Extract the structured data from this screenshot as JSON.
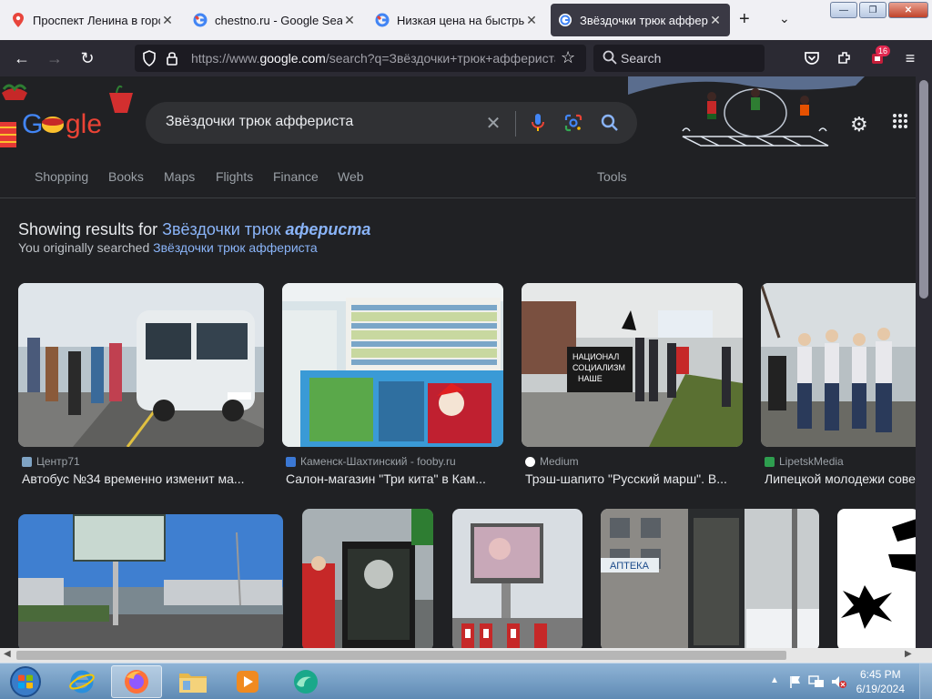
{
  "tabs": [
    {
      "title": "Проспект Ленина в город",
      "icon": "map-pin-icon",
      "active": false
    },
    {
      "title": "chestno.ru - Google Search",
      "icon": "google-icon",
      "active": false
    },
    {
      "title": "Низкая цена на быстрый",
      "icon": "google-icon",
      "active": false
    },
    {
      "title": "Звёздочки трюк аффери",
      "icon": "google-icon",
      "active": true
    }
  ],
  "window_buttons": {
    "minimize": "—",
    "maximize": "❐",
    "close": "✕"
  },
  "nav": {
    "url_prefix": "https://www.",
    "url_domain": "google.com",
    "url_rest": "/search?q=Звёздочки+трюк+аффериста",
    "search_placeholder": "Search",
    "extension_badge": "16"
  },
  "google": {
    "query": "Звёздочки трюк аффериста",
    "filters": [
      "Shopping",
      "Books",
      "Maps",
      "Flights",
      "Finance",
      "Web"
    ],
    "tools_label": "Tools",
    "showing_prefix": "Showing results for ",
    "showing_plain": "Звёздочки трюк ",
    "showing_bold": "афериста",
    "orig_prefix": "You originally searched ",
    "orig_link": "Звёздочки трюк аффериста"
  },
  "results_row1": [
    {
      "source": "Центр71",
      "title": "Автобус №34 временно изменит ма...",
      "fav_color": "#7fa3c4"
    },
    {
      "source": "Каменск-Шахтинский - fooby.ru",
      "title": "Салон-магазин \"Три кита\" в Кам...",
      "fav_color": "#3b78d4"
    },
    {
      "source": "Medium",
      "title": "Трэш-шапито \"Русский марш\". В...",
      "fav_color": "#ffffff"
    },
    {
      "source": "LipetskMedia",
      "title": "Липецкой молодежи сове",
      "fav_color": "#2e9e4f"
    }
  ],
  "taskbar": {
    "time": "6:45 PM",
    "date": "6/19/2024"
  },
  "colors": {
    "link": "#8ab4f8",
    "page_bg": "#202124"
  }
}
